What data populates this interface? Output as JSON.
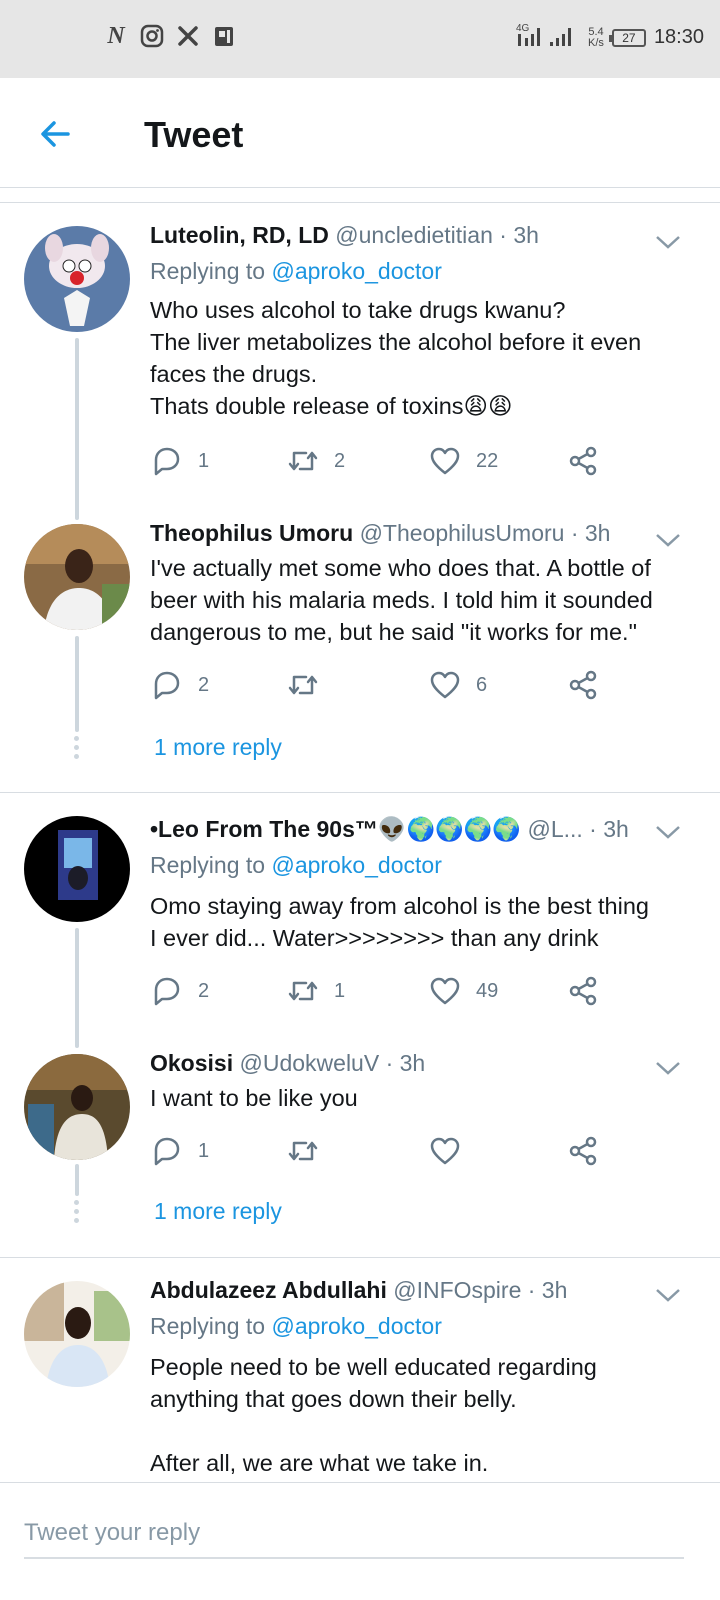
{
  "status_bar": {
    "left_icons": [
      "netflix-icon",
      "instagram-icon",
      "x-icon",
      "clipboard-icon"
    ],
    "network_type": "4G",
    "net_speed_value": "5.4",
    "net_speed_unit": "K/s",
    "battery": "27",
    "time": "18:30"
  },
  "header": {
    "title": "Tweet"
  },
  "tweets": [
    {
      "name": "Luteolin, RD, LD",
      "handle": "@uncledietitian",
      "time": "· 3h",
      "replying_label": "Replying to",
      "replying_to": "@aproko_doctor",
      "text_lines": [
        "Who uses alcohol to take drugs kwanu?",
        "The liver metabolizes the alcohol before it even",
        "faces the drugs.",
        "Thats double release of toxins😩😩"
      ],
      "replies": "1",
      "retweets": "2",
      "likes": "22"
    },
    {
      "name": "Theophilus Umoru",
      "handle": "@TheophilusUmoru",
      "time": "· 3h",
      "text_lines": [
        "I've actually met some who does that. A bottle of",
        "beer with his malaria meds. I told him it sounded",
        "dangerous to me, but he said \"it works for me.\""
      ],
      "replies": "2",
      "retweets": "",
      "likes": "6"
    },
    {
      "name": "•Leo From The 90s™👽🌍🌍🌍🌍",
      "handle": "@L...",
      "time": "· 3h",
      "replying_label": "Replying to",
      "replying_to": "@aproko_doctor",
      "text_lines": [
        "Omo staying away from alcohol is the best thing",
        "I ever did... Water>>>>>>>> than any drink"
      ],
      "replies": "2",
      "retweets": "1",
      "likes": "49"
    },
    {
      "name": "Okosisi",
      "handle": "@UdokweluV",
      "time": "· 3h",
      "text_lines": [
        "I want to be like you"
      ],
      "replies": "1",
      "retweets": "",
      "likes": ""
    },
    {
      "name": "Abdulazeez Abdullahi",
      "handle": "@INFOspire",
      "time": "· 3h",
      "replying_label": "Replying to",
      "replying_to": "@aproko_doctor",
      "text_lines": [
        "People need to be well educated regarding",
        "anything that goes down their belly.",
        "",
        "After all, we are what we take in."
      ]
    }
  ],
  "more_replies": [
    "1 more reply",
    "1 more reply"
  ],
  "reply_bar": {
    "placeholder": "Tweet your reply"
  },
  "colors": {
    "accent": "#1b95e0",
    "secondary_text": "#657786",
    "status_bar_bg": "#e6e6e6"
  }
}
